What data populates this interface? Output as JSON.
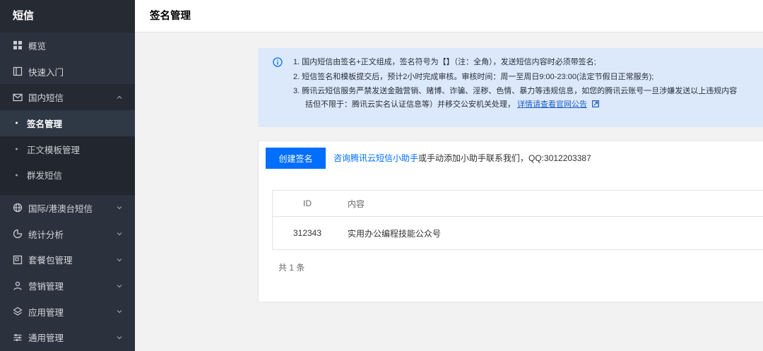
{
  "sidebar": {
    "title": "短信",
    "items": [
      {
        "label": "概览"
      },
      {
        "label": "快速入门"
      },
      {
        "label": "国内短信"
      },
      {
        "label": "国际/港澳台短信"
      },
      {
        "label": "统计分析"
      },
      {
        "label": "套餐包管理"
      },
      {
        "label": "营销管理"
      },
      {
        "label": "应用管理"
      },
      {
        "label": "通用管理"
      }
    ],
    "sub_items": [
      {
        "label": "签名管理"
      },
      {
        "label": "正文模板管理"
      },
      {
        "label": "群发短信"
      }
    ]
  },
  "header": {
    "title": "签名管理"
  },
  "notice": {
    "line1": "1. 国内短信由签名+正文组成，签名符号为【】（注：全角），发送短信内容时必须带签名;",
    "line2": "2. 短信签名和模板提交后，预计2小时完成审核。审核时间：周一至周日9:00-23:00(法定节假日正常服务);",
    "line3": "3. 腾讯云短信服务严禁发送金融营销、赌博、诈骗、淫秽、色情、暴力等违规信息，如您的腾讯云账号一旦涉嫌发送以上违规内容",
    "line4_text": "括但不限于：腾讯云实名认证信息等）并移交公安机关处理，",
    "line4_link": "详情请查看官网公告"
  },
  "toolbar": {
    "create_label": "创建签名",
    "helper_link": "咨询腾讯云短信小助手",
    "helper_text": "或手动添加小助手联系我们，QQ:3012203387"
  },
  "table": {
    "headers": [
      "ID",
      "内容"
    ],
    "rows": [
      {
        "id": "312343",
        "content": "实用办公编程技能公众号"
      }
    ]
  },
  "footer": {
    "total": "共 1 条"
  },
  "colors": {
    "sidebar_bg": "#2b313d",
    "accent": "#006eff",
    "notice_bg": "#dce9fb"
  }
}
